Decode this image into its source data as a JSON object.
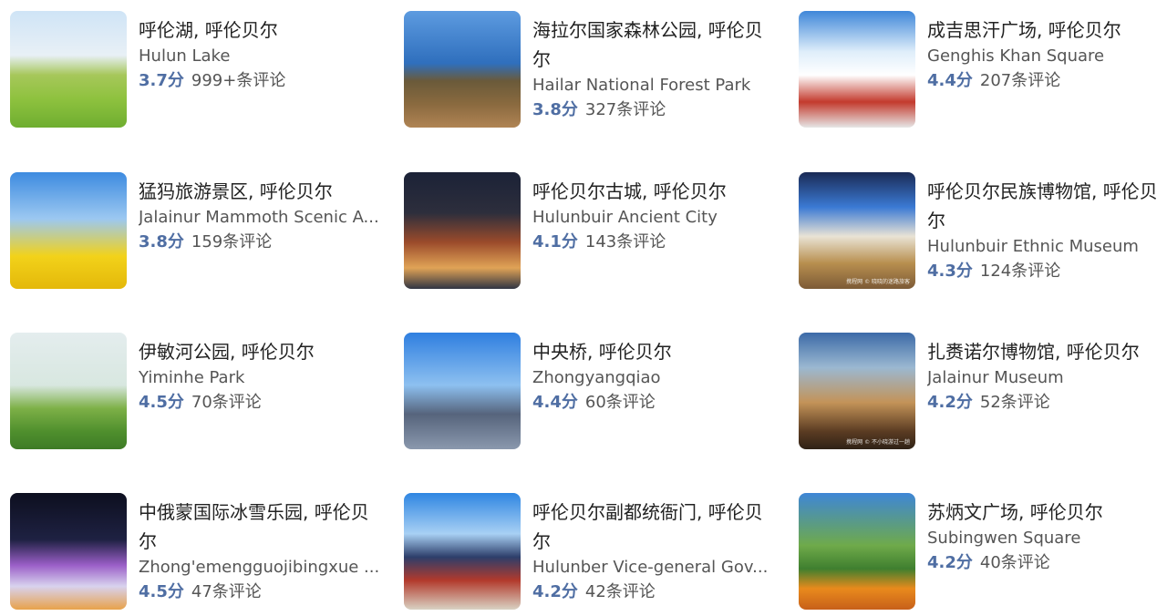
{
  "items": [
    {
      "title": "呼伦湖, 呼伦贝尔",
      "en": "Hulun Lake",
      "score": "3.7分",
      "reviews": "999+条评论"
    },
    {
      "title": "海拉尔国家森林公园, 呼伦贝尔",
      "en": "Hailar National Forest Park",
      "score": "3.8分",
      "reviews": "327条评论"
    },
    {
      "title": "成吉思汗广场, 呼伦贝尔",
      "en": "Genghis Khan Square",
      "score": "4.4分",
      "reviews": "207条评论"
    },
    {
      "title": "猛犸旅游景区, 呼伦贝尔",
      "en": "Jalainur Mammoth Scenic A...",
      "score": "3.8分",
      "reviews": "159条评论"
    },
    {
      "title": "呼伦贝尔古城, 呼伦贝尔",
      "en": "Hulunbuir Ancient City",
      "score": "4.1分",
      "reviews": "143条评论"
    },
    {
      "title": "呼伦贝尔民族博物馆, 呼伦贝尔",
      "en": "Hulunbuir Ethnic Museum",
      "score": "4.3分",
      "reviews": "124条评论",
      "watermark": "携程网 © 晓晓的迷路旅客"
    },
    {
      "title": "伊敏河公园, 呼伦贝尔",
      "en": "Yiminhe Park",
      "score": "4.5分",
      "reviews": "70条评论"
    },
    {
      "title": "中央桥, 呼伦贝尔",
      "en": "Zhongyangqiao",
      "score": "4.4分",
      "reviews": "60条评论"
    },
    {
      "title": "扎赉诺尔博物馆, 呼伦贝尔",
      "en": "Jalainur Museum",
      "score": "4.2分",
      "reviews": "52条评论",
      "watermark": "携程网 © 不小晓游过一趟"
    },
    {
      "title": "中俄蒙国际冰雪乐园, 呼伦贝尔",
      "en": "Zhong'emengguojibingxue ...",
      "score": "4.5分",
      "reviews": "47条评论"
    },
    {
      "title": "呼伦贝尔副都统衙门, 呼伦贝尔",
      "en": "Hulunber Vice-general Gov...",
      "score": "4.2分",
      "reviews": "42条评论"
    },
    {
      "title": "苏炳文广场, 呼伦贝尔",
      "en": "Subingwen Square",
      "score": "4.2分",
      "reviews": "40条评论"
    }
  ],
  "colors": {
    "score": "#4f6ea3",
    "title": "#222222",
    "subtext": "#555555"
  }
}
